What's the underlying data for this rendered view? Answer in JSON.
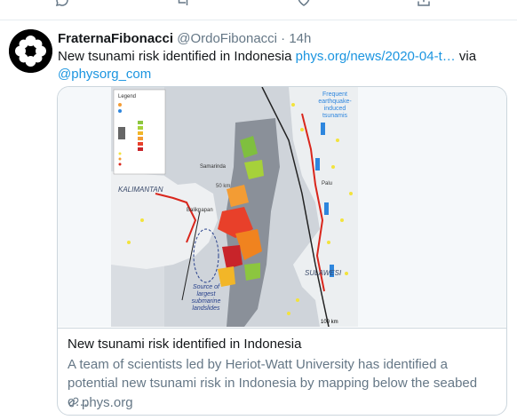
{
  "tweet": {
    "author": {
      "display_name": "FraternaFibonacci",
      "handle": "@OrdoFibonacci",
      "separator": "·",
      "time": "14h"
    },
    "text": {
      "body": "New tsunami risk identified in Indonesia",
      "url": "phys.org/news/2020-04-t…",
      "via": "via",
      "mention": "@physorg_com"
    },
    "card": {
      "title": "New tsunami risk identified in Indonesia",
      "description": "A team of scientists led by Heriot-Watt University has identified a potential new tsunami risk in Indonesia by mapping below the seabed o…",
      "domain": "phys.org",
      "map": {
        "legend_title": "Legend",
        "labels": {
          "kalimantan": "KALIMANTAN",
          "sulawesi": "SULAWESI",
          "samarinda": "Samarinda",
          "balikpapan": "Balikpapan",
          "palu": "Palu",
          "source": [
            "Source of",
            "largest",
            "submarine",
            "landslides"
          ],
          "frequent": [
            "Frequent",
            "earthquake-",
            "induced",
            "tsunamis"
          ],
          "scale": "100 km",
          "depth": "50 km"
        }
      }
    }
  },
  "colors": {
    "link": "#1b95e0",
    "secondary_text": "#657786",
    "border": "#ccd6dd"
  },
  "icons": [
    "reply-icon",
    "retweet-icon",
    "like-icon",
    "share-icon",
    "link-icon"
  ]
}
